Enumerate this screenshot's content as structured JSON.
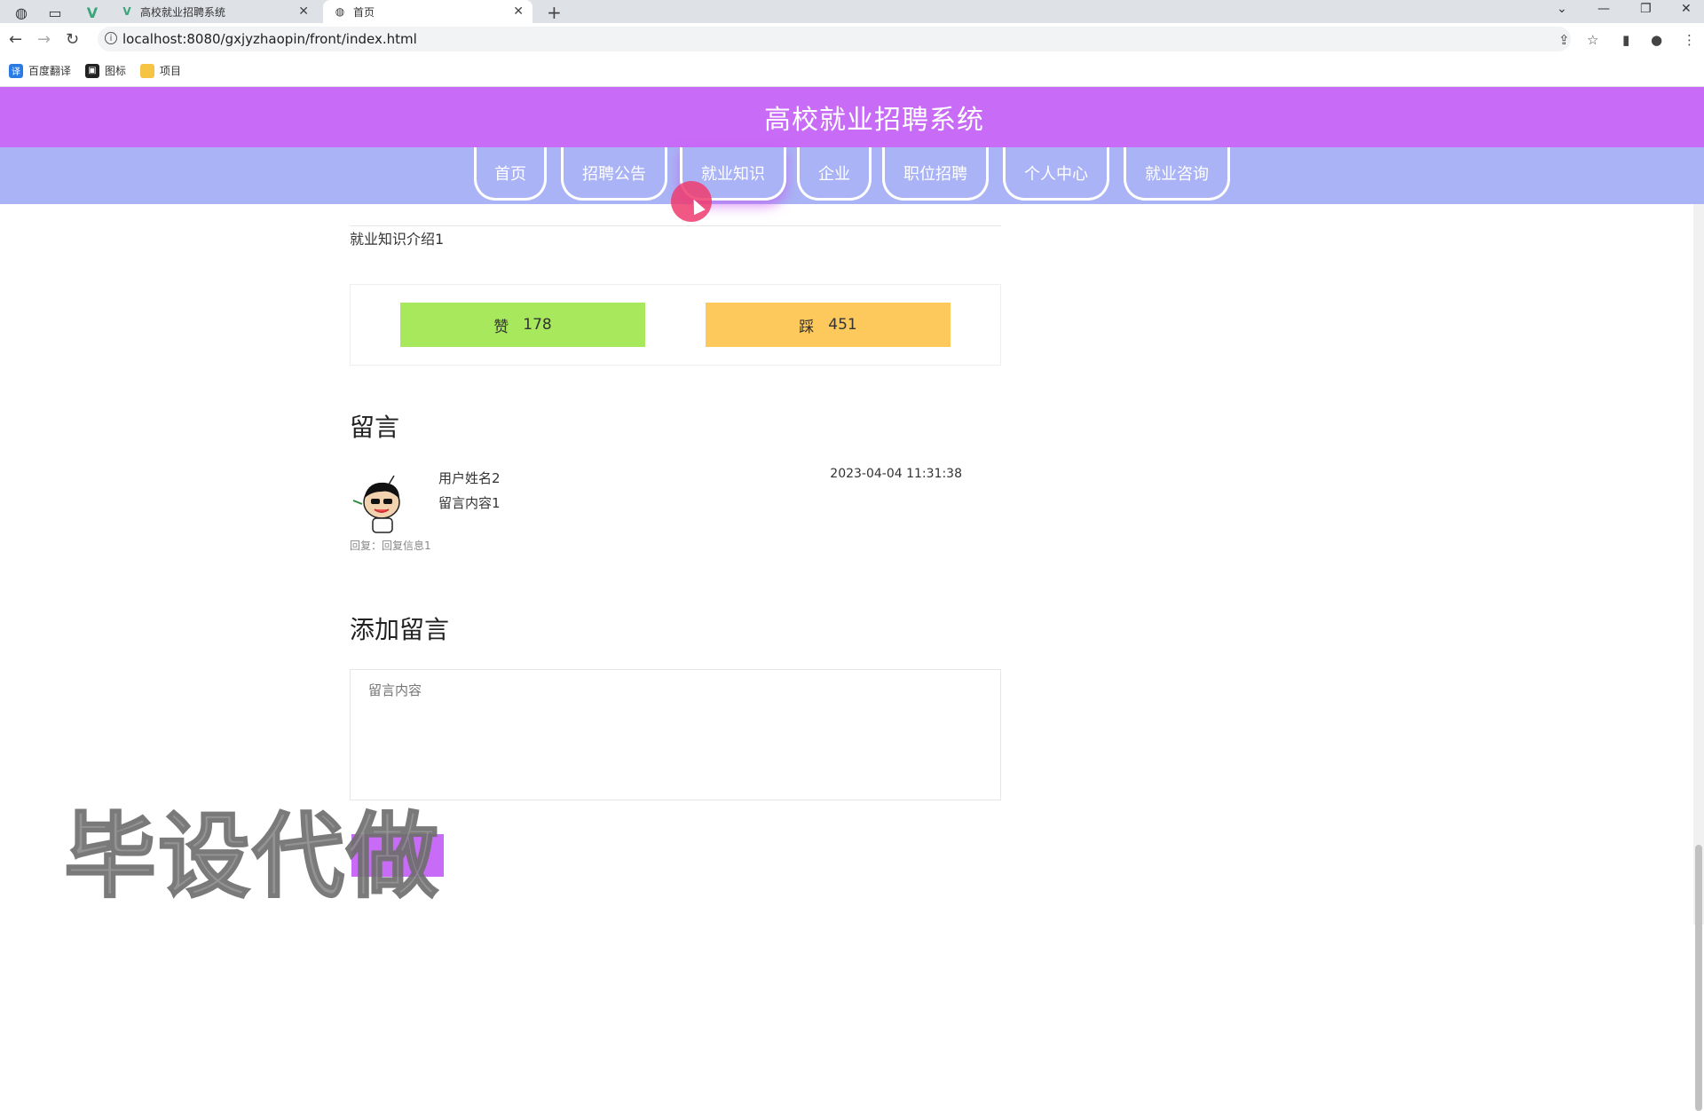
{
  "browser": {
    "tabs": [
      {
        "title": "高校就业招聘系统",
        "active": false
      },
      {
        "title": "首页",
        "active": true
      }
    ],
    "url": "localhost:8080/gxjyzhaopin/front/index.html",
    "bookmarks": [
      {
        "label": "百度翻译",
        "icon": "translate-icon"
      },
      {
        "label": "图标",
        "icon": "image-icon"
      },
      {
        "label": "项目",
        "icon": "folder-icon"
      }
    ]
  },
  "site": {
    "title": "高校就业招聘系统",
    "nav": [
      {
        "label": "首页"
      },
      {
        "label": "招聘公告"
      },
      {
        "label": "就业知识",
        "active": true
      },
      {
        "label": "企业"
      },
      {
        "label": "职位招聘"
      },
      {
        "label": "个人中心"
      },
      {
        "label": "就业咨询"
      }
    ]
  },
  "article": {
    "intro": "就业知识介绍1",
    "like_label": "赞",
    "like_count": "178",
    "dislike_label": "踩",
    "dislike_count": "451"
  },
  "comments": {
    "heading": "留言",
    "items": [
      {
        "user": "用户姓名2",
        "content": "留言内容1",
        "time": "2023-04-04 11:31:38",
        "reply": "回复：回复信息1"
      }
    ]
  },
  "add_comment": {
    "heading": "添加留言",
    "placeholder": "留言内容"
  },
  "watermark": "毕设代做",
  "colors": {
    "header": "#c86bf7",
    "nav": "#a9b3f5",
    "like": "#a8e85c",
    "dislike": "#fdc95c"
  }
}
